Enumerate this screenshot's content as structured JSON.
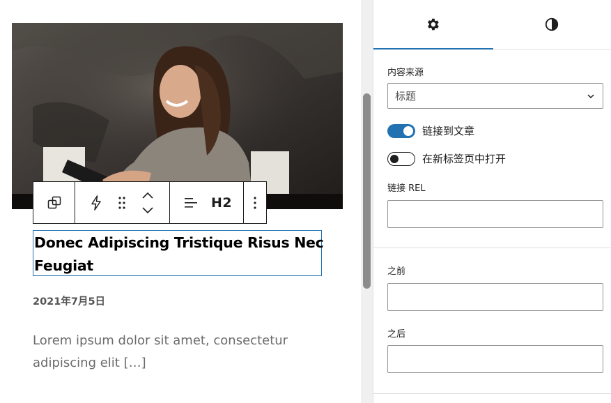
{
  "post": {
    "title_line1": "Donec Adipiscing Tristique Risus Nec",
    "title_line2": "Feugiat",
    "date": "2021年7月5日",
    "excerpt_line1": "Lorem ipsum dolor sit amet, consectetur",
    "excerpt_line2": "adipiscing elit […]"
  },
  "toolbar": {
    "heading_level": "H2"
  },
  "sidebar": {
    "tabs": [
      {
        "icon": "gear-icon",
        "active": true
      },
      {
        "icon": "contrast-icon",
        "active": false
      }
    ],
    "content_source_label": "内容来源",
    "content_source_value": "标题",
    "link_to_post_label": "链接到文章",
    "link_to_post_on": true,
    "open_new_tab_label": "在新标签页中打开",
    "open_new_tab_on": false,
    "link_rel_label": "链接 REL",
    "link_rel_value": "",
    "before_label": "之前",
    "before_value": "",
    "after_label": "之后",
    "after_value": ""
  },
  "colors": {
    "accent": "#2271b1",
    "border": "#949494",
    "divider": "#e0e0e0"
  }
}
